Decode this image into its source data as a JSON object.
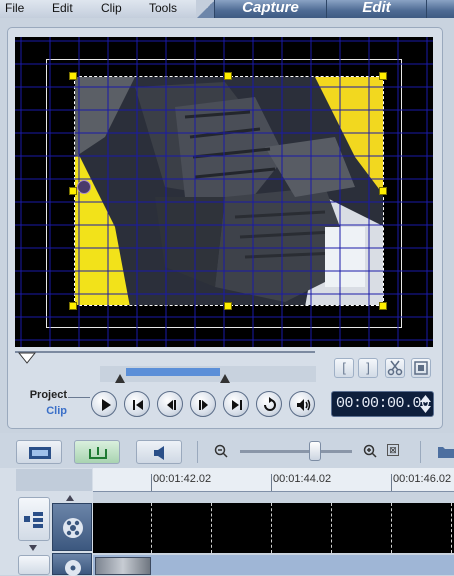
{
  "menu": {
    "file": "File",
    "edit": "Edit",
    "clip": "Clip",
    "tools": "Tools"
  },
  "modes": {
    "capture": "Capture",
    "edit": "Edit"
  },
  "transport": {
    "project_label": "Project",
    "clip_label": "Clip",
    "timecode": "00:00:00.00"
  },
  "trim_brackets": {
    "mark_in": "[",
    "mark_out": "]"
  },
  "ruler": {
    "t1": "00:01:42.02",
    "t2": "00:01:44.02",
    "t3": "00:01:46.02"
  },
  "colors": {
    "accent_blue": "#5b8fd8",
    "grid_blue": "#1a1aa8",
    "handle_yellow": "#ffee00",
    "timecode_bg": "#0e1f3c"
  }
}
